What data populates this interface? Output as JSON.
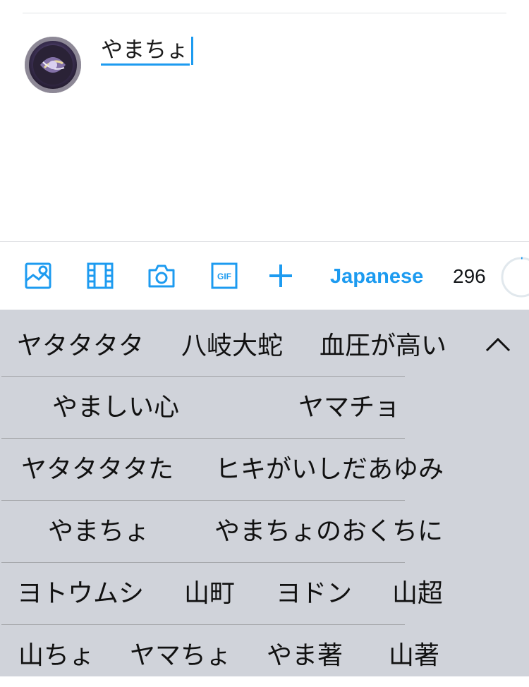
{
  "compose": {
    "text": "やまちょ"
  },
  "avatar": {
    "icon": "avatar-image"
  },
  "toolbar": {
    "icons": [
      "image-icon",
      "video-icon",
      "camera-icon",
      "gif-icon",
      "add-icon"
    ],
    "language": "Japanese",
    "char_count": "296",
    "accent_color": "#1d9bf0"
  },
  "candidates": {
    "row1": [
      "ヤタタタタ",
      "八岐大蛇",
      "血圧が高い"
    ],
    "row2": [
      "やましい心",
      "ヤマチョ"
    ],
    "row3": [
      "ヤタタタタた",
      "ヒキがいしだあゆみ"
    ],
    "row4": [
      "やまちょ",
      "やまちょのおくちに"
    ],
    "row5": [
      "ヨトウムシ",
      "山町",
      "ヨドン",
      "山超"
    ],
    "row6": [
      "山ちょ",
      "ヤマちょ",
      "やま著",
      "山著"
    ],
    "collapse_icon": "chevron-up-icon",
    "background": "#d0d3da"
  }
}
